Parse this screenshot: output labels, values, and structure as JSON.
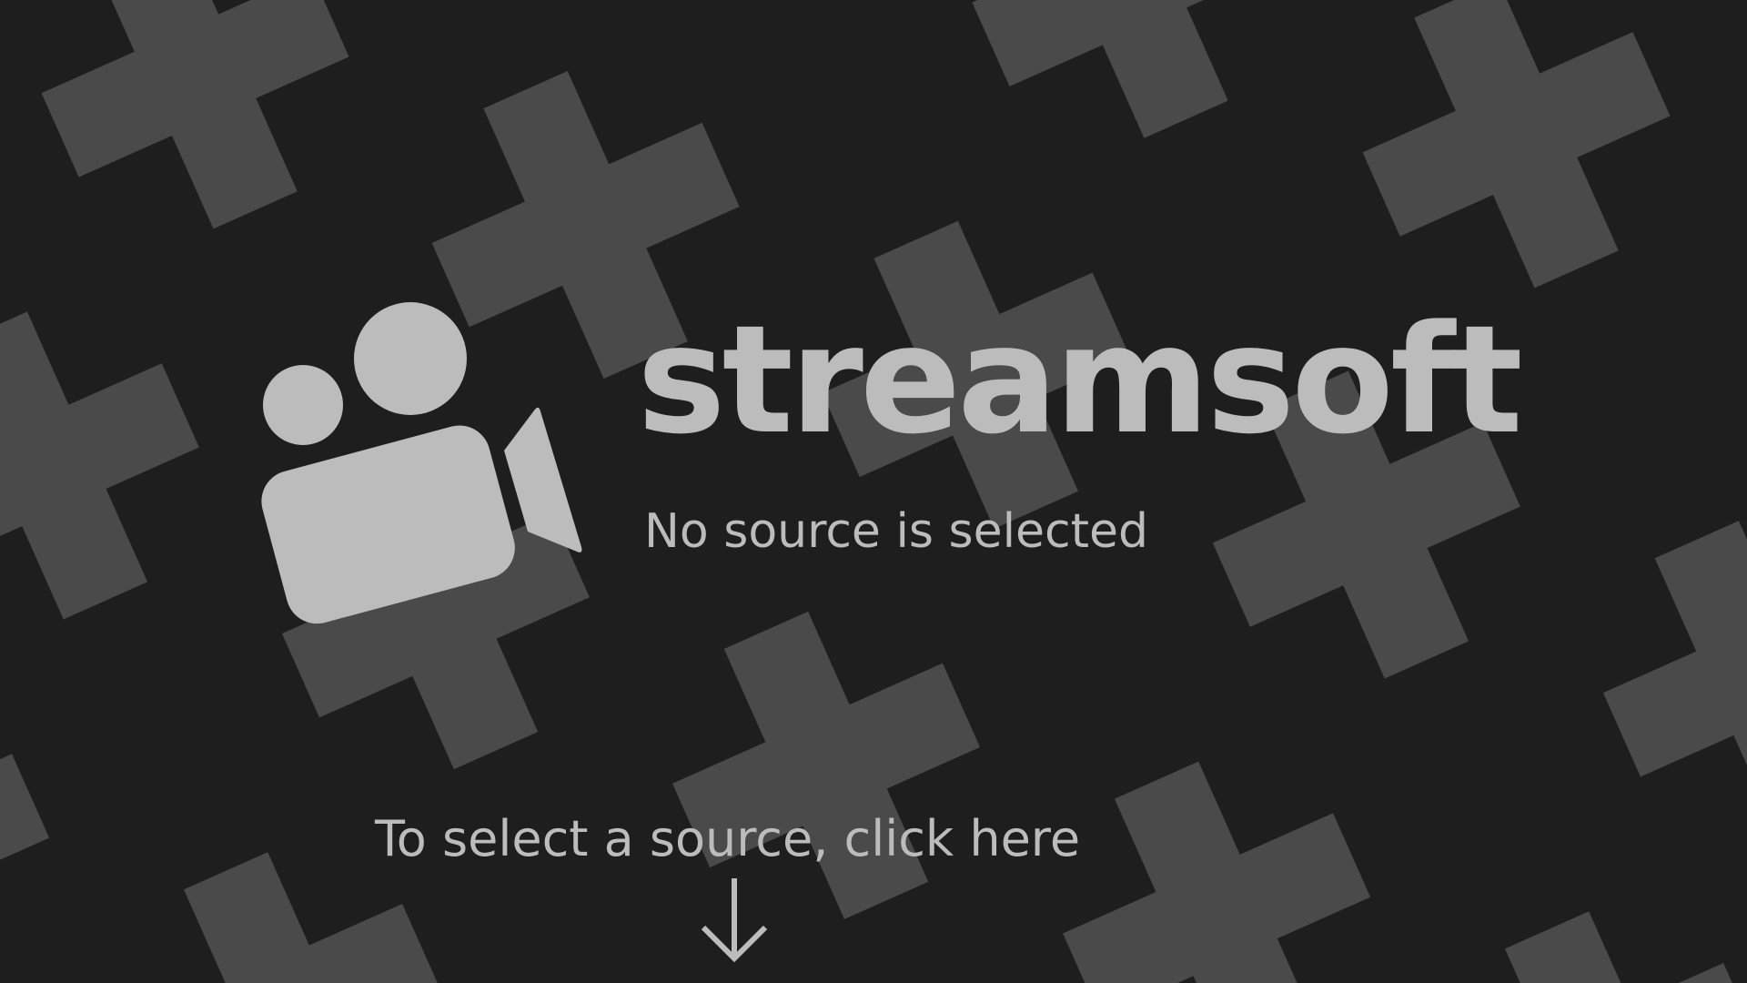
{
  "colors": {
    "background": "#1e1e1e",
    "pattern": "#4a4a4a",
    "foreground": "#bcbcbc"
  },
  "brand": {
    "name": "streamsoft",
    "icon": "video-camera-icon"
  },
  "status": {
    "message": "No source is selected"
  },
  "hint": {
    "text": "To select a source, click here",
    "icon": "arrow-down-icon"
  }
}
